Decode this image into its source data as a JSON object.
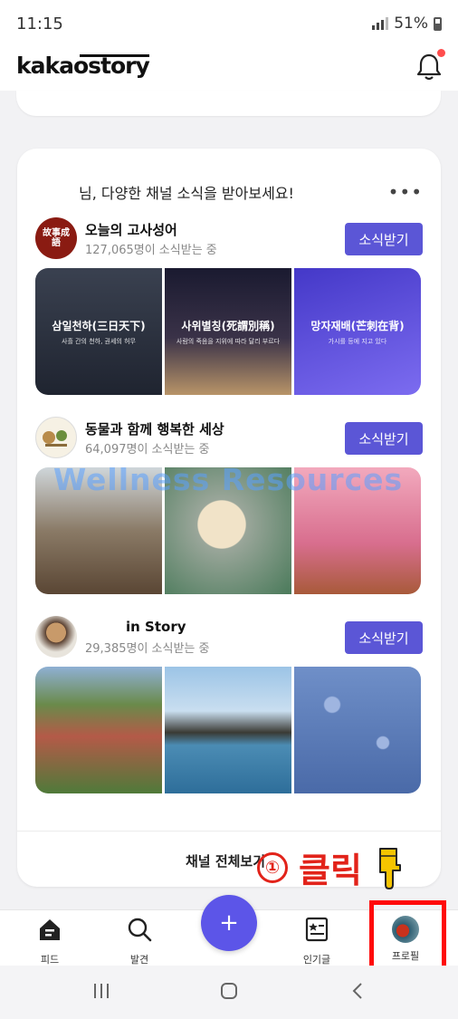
{
  "status": {
    "time": "11:15",
    "battery": "51%"
  },
  "app": {
    "logo": "kakaostory"
  },
  "card": {
    "title": "님, 다양한 채널 소식을 받아보세요!",
    "more": "•••",
    "channels": [
      {
        "name": "오늘의 고사성어",
        "subscribers": "127,065명이 소식받는 중",
        "button": "소식받기",
        "avatar_text": "故事成語",
        "thumbs": [
          {
            "title": "삼일천하(三日天下)",
            "sub": "사흘 간의 천하, 권세의 허무"
          },
          {
            "title": "사위별칭(死謂別稱)",
            "sub": "사람의 죽음을 지위에 따라 달리 부르다"
          },
          {
            "title": "망자재배(芒刺在背)",
            "sub": "가시를 등에 지고 있다"
          }
        ]
      },
      {
        "name": "동물과 함께 행복한 세상",
        "subscribers": "64,097명이 소식받는 중",
        "button": "소식받기",
        "watermark": "Wellness Resources"
      },
      {
        "name": "in Story",
        "subscribers": "29,385명이 소식받는 중",
        "button": "소식받기"
      }
    ],
    "all_channels": "채널 전체보기"
  },
  "annotation": {
    "number": "①",
    "text": "클릭"
  },
  "nav": {
    "feed": "피드",
    "discover": "발견",
    "add": "+",
    "popular": "인기글",
    "profile": "프로필"
  },
  "colors": {
    "accent": "#5b56d6",
    "annotation": "#e2231a"
  }
}
